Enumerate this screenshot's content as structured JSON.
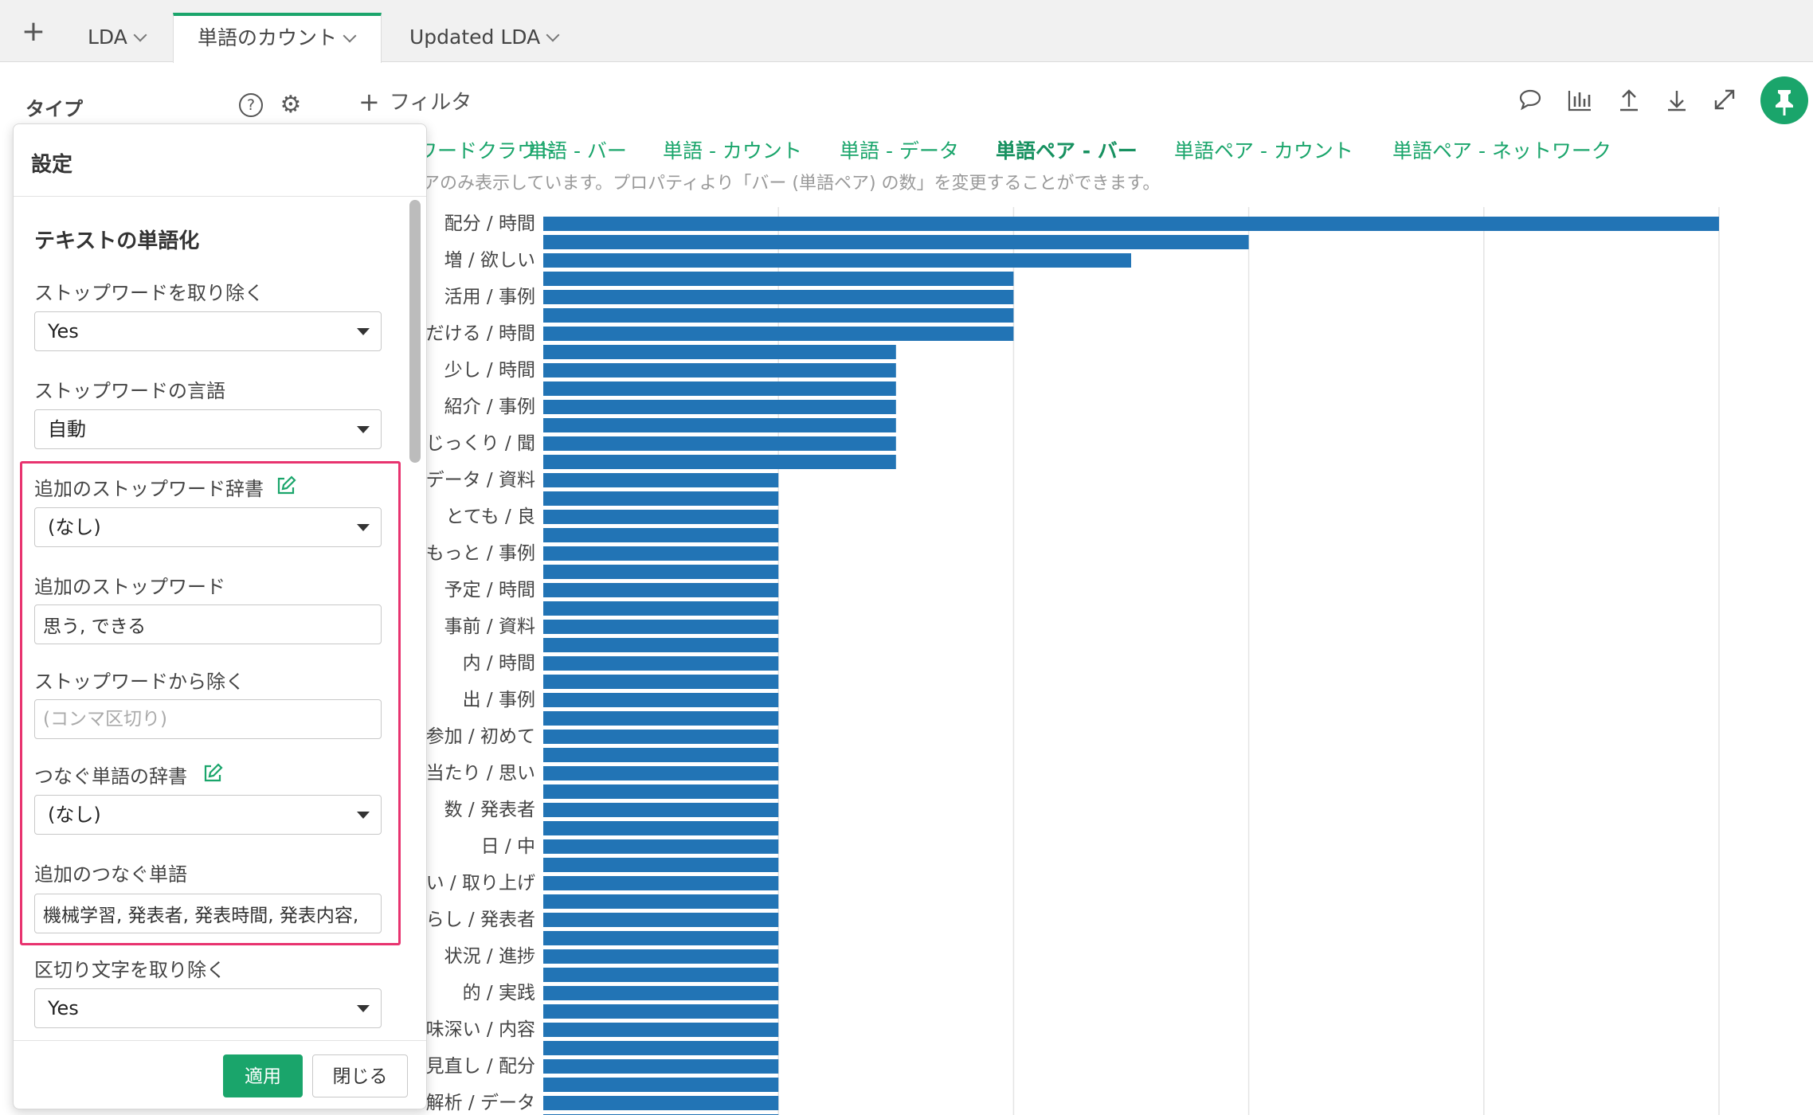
{
  "tabs": [
    {
      "label": "LDA"
    },
    {
      "label": "単語のカウント",
      "active": true
    },
    {
      "label": "Updated LDA"
    }
  ],
  "toolbar": {
    "type_label": "タイプ",
    "filter_label": "フィルタ",
    "icons": [
      "comment-icon",
      "chart-icon",
      "upload-icon",
      "download-icon",
      "expand-icon",
      "pin-icon"
    ]
  },
  "chart_tabs": [
    {
      "label": "ワードクラウド"
    },
    {
      "label": "単語 - バー"
    },
    {
      "label": "単語 - カウント"
    },
    {
      "label": "単語 - データ"
    },
    {
      "label": "単語ペア - バー",
      "active": true
    },
    {
      "label": "単語ペア - カウント"
    },
    {
      "label": "単語ペア - ネットワーク"
    }
  ],
  "info_text": "アのみ表示しています。プロパティより「バー (単語ペア) の数」を変更することができます。",
  "settings": {
    "title": "設定",
    "section_title": "テキストの単語化",
    "stopwords_remove": {
      "label": "ストップワードを取り除く",
      "value": "Yes"
    },
    "stopwords_lang": {
      "label": "ストップワードの言語",
      "value": "自動"
    },
    "extra_stopword_dict": {
      "label": "追加のストップワード辞書",
      "value": "(なし)"
    },
    "extra_stopwords": {
      "label": "追加のストップワード",
      "value": "思う, できる"
    },
    "exclude_from_stopwords": {
      "label": "ストップワードから除く",
      "placeholder": "(コンマ区切り)"
    },
    "compound_dict": {
      "label": "つなぐ単語の辞書",
      "value": "(なし)"
    },
    "extra_compound": {
      "label": "追加のつなぐ単語",
      "value": "機械学習, 発表者, 発表時間, 発表内容,"
    },
    "remove_punct": {
      "label": "区切り文字を取り除く",
      "value": "Yes"
    },
    "apply_label": "適用",
    "close_label": "閉じる"
  },
  "colors": {
    "accent": "#1aa56b",
    "bar": "#2274b5",
    "highlight": "#e8336f"
  },
  "chart_data": {
    "type": "bar",
    "orientation": "horizontal",
    "labels": [
      "配分 / 時間",
      "増 / 欲しい",
      "活用 / 事例",
      "だける / 時間",
      "少し / 時間",
      "紹介 / 事例",
      "じっくり / 聞",
      "データ / 資料",
      "とても / 良",
      "もっと / 事例",
      "予定 / 時間",
      "事前 / 資料",
      "内 / 時間",
      "出 / 事例",
      "参加 / 初めて",
      "当たり / 思い",
      "数 / 発表者",
      "日 / 中",
      "い / 取り上げ",
      "らし / 発表者",
      "状況 / 進捗",
      "的 / 実践",
      "味深い / 内容",
      "見直し / 配分",
      "解析 / データ"
    ],
    "values": [
      10,
      6,
      5,
      4,
      4,
      4,
      4,
      3,
      3,
      3,
      3,
      3,
      3,
      3,
      2,
      2,
      2,
      2,
      2,
      2,
      2,
      2,
      2,
      2,
      2,
      2,
      2,
      2,
      2,
      2,
      2,
      2,
      2,
      2,
      2,
      2,
      2,
      2,
      2,
      2,
      2,
      2,
      2,
      2,
      2,
      2,
      2,
      2,
      2,
      2
    ],
    "xlim": [
      0,
      10
    ],
    "grid": true
  }
}
